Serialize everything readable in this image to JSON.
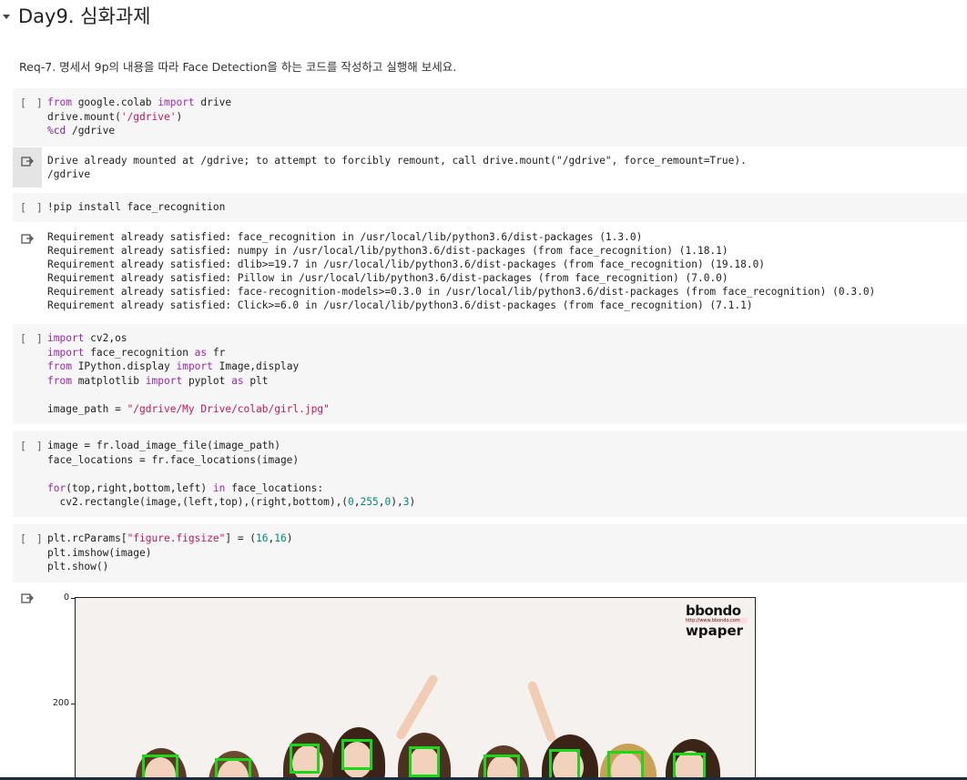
{
  "section": {
    "title": "Day9. 심화과제"
  },
  "description": "Req-7. 명세서 9p의 내용을 따라 Face Detection을 하는 코드를 작성하고 실행해 보세요.",
  "cells": {
    "run_marker": "[ ]",
    "cell1": {
      "lines": [
        "from google.colab import drive",
        "drive.mount('/gdrive')",
        "%cd /gdrive"
      ]
    },
    "out1": {
      "lines": [
        "Drive already mounted at /gdrive; to attempt to forcibly remount, call drive.mount(\"/gdrive\", force_remount=True).",
        "/gdrive"
      ]
    },
    "cell2": {
      "lines": [
        "!pip install face_recognition"
      ]
    },
    "out2": {
      "lines": [
        "Requirement already satisfied: face_recognition in /usr/local/lib/python3.6/dist-packages (1.3.0)",
        "Requirement already satisfied: numpy in /usr/local/lib/python3.6/dist-packages (from face_recognition) (1.18.1)",
        "Requirement already satisfied: dlib>=19.7 in /usr/local/lib/python3.6/dist-packages (from face_recognition) (19.18.0)",
        "Requirement already satisfied: Pillow in /usr/local/lib/python3.6/dist-packages (from face_recognition) (7.0.0)",
        "Requirement already satisfied: face-recognition-models>=0.3.0 in /usr/local/lib/python3.6/dist-packages (from face_recognition) (0.3.0)",
        "Requirement already satisfied: Click>=6.0 in /usr/local/lib/python3.6/dist-packages (from face_recognition) (7.1.1)"
      ]
    },
    "cell3": {
      "lines": [
        "import cv2,os",
        "import face_recognition as fr",
        "from IPython.display import Image,display",
        "from matplotlib import pyplot as plt",
        "",
        "image_path = \"/gdrive/My Drive/colab/girl.jpg\""
      ]
    },
    "cell4": {
      "lines": [
        "image = fr.load_image_file(image_path)",
        "face_locations = fr.face_locations(image)",
        "",
        "for(top,right,bottom,left) in face_locations:",
        "  cv2.rectangle(image,(left,top),(right,bottom),(0,255,0),3)"
      ]
    },
    "cell5": {
      "lines": [
        "plt.rcParams[\"figure.figsize\"] = (16,16)",
        "plt.imshow(image)",
        "plt.show()"
      ]
    }
  },
  "plot": {
    "yticks": [
      "0",
      "200"
    ],
    "logo": {
      "line1": "bbondo",
      "line2": "http://www.bbondo.com",
      "line3": "wpaper"
    }
  }
}
